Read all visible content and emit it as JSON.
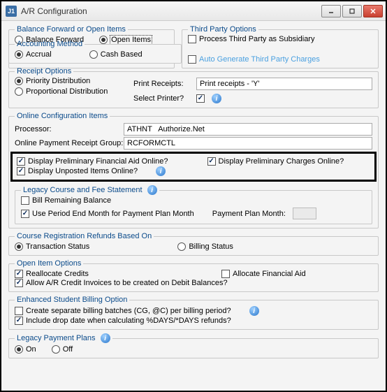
{
  "window": {
    "app_icon_text": "J1",
    "title": "A/R Configuration"
  },
  "balance_forward": {
    "legend": "Balance Forward or Open Items",
    "opt_balance": "Balance Forward",
    "opt_open": "Open Items"
  },
  "third_party": {
    "legend": "Third Party Options",
    "opt_subsidiary": "Process Third Party as Subsidiary",
    "opt_autogen": "Auto Generate Third Party Charges"
  },
  "accounting": {
    "legend": "Accounting Method",
    "opt_accrual": "Accrual",
    "opt_cash": "Cash Based"
  },
  "receipt": {
    "legend": "Receipt Options",
    "opt_priority": "Priority Distribution",
    "opt_proportional": "Proportional Distribution",
    "print_receipts_label": "Print Receipts:",
    "print_receipts_value": "Print receipts - 'Y'",
    "select_printer_label": "Select Printer?"
  },
  "online": {
    "legend": "Online Configuration Items",
    "processor_label": "Processor:",
    "processor_value": "ATHNT   Authorize.Net",
    "receipt_group_label": "Online Payment Receipt Group:",
    "receipt_group_value": "RCFORMCTL",
    "disp_prelim_aid": "Display Preliminary Financial Aid Online?",
    "disp_prelim_charges": "Display Preliminary Charges Online?",
    "disp_unposted": "Display Unposted Items Online?",
    "legacy_legend": "Legacy Course and Fee Statement",
    "bill_remaining": "Bill Remaining Balance",
    "use_period_end": "Use Period End Month for Payment Plan Month",
    "payment_plan_month": "Payment Plan Month:"
  },
  "refunds": {
    "legend": "Course Registration Refunds Based On",
    "opt_trans": "Transaction Status",
    "opt_billing": "Billing Status"
  },
  "open_item": {
    "legend": "Open Item Options",
    "reallocate": "Reallocate Credits",
    "allocate_fa": "Allocate Financial Aid",
    "allow_credit": "Allow A/R Credit Invoices to be created on Debit Balances?"
  },
  "enhanced": {
    "legend": "Enhanced Student Billing Option",
    "create_batches": "Create separate billing batches (CG, @C) per billing period?",
    "include_drop": "Include drop date when calculating %DAYS/*DAYS refunds?"
  },
  "legacy_plans": {
    "legend": "Legacy Payment Plans",
    "opt_on": "On",
    "opt_off": "Off"
  }
}
